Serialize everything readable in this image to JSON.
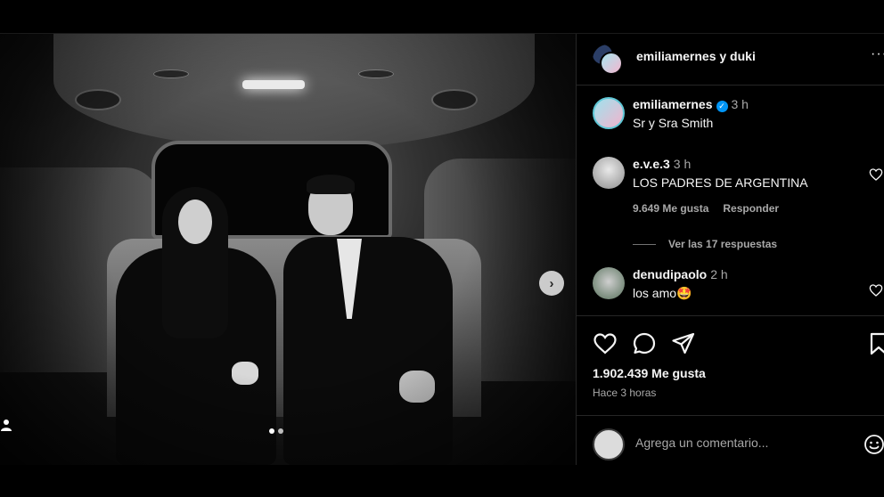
{
  "post": {
    "photo_alt": "",
    "carousel": {
      "count": 2,
      "active": 0
    }
  },
  "header": {
    "title": "emiliamernes y duki",
    "more_glyph": "···"
  },
  "caption": {
    "user": "emiliamernes",
    "time": "3 h",
    "text": "Sr y Sra Smith",
    "verified": true
  },
  "comments": [
    {
      "user": "e.v.e.3",
      "time": "3 h",
      "text": "LOS PADRES DE ARGENTINA",
      "likes": "9.649 Me gusta",
      "reply": "Responder",
      "view_replies": "Ver las 17 respuestas"
    },
    {
      "user": "denudipaolo",
      "time": "2 h",
      "text": "los amo🤩"
    }
  ],
  "actions": {
    "like_count": "1.902.439 Me gusta",
    "posted_ago": "Hace 3 horas"
  },
  "composer": {
    "placeholder": "Agrega un comentario..."
  },
  "colors": {
    "background": "#000000",
    "text": "#f5f5f5",
    "secondary": "#a8a8a8",
    "verified": "#0095f6",
    "divider": "#262626"
  }
}
